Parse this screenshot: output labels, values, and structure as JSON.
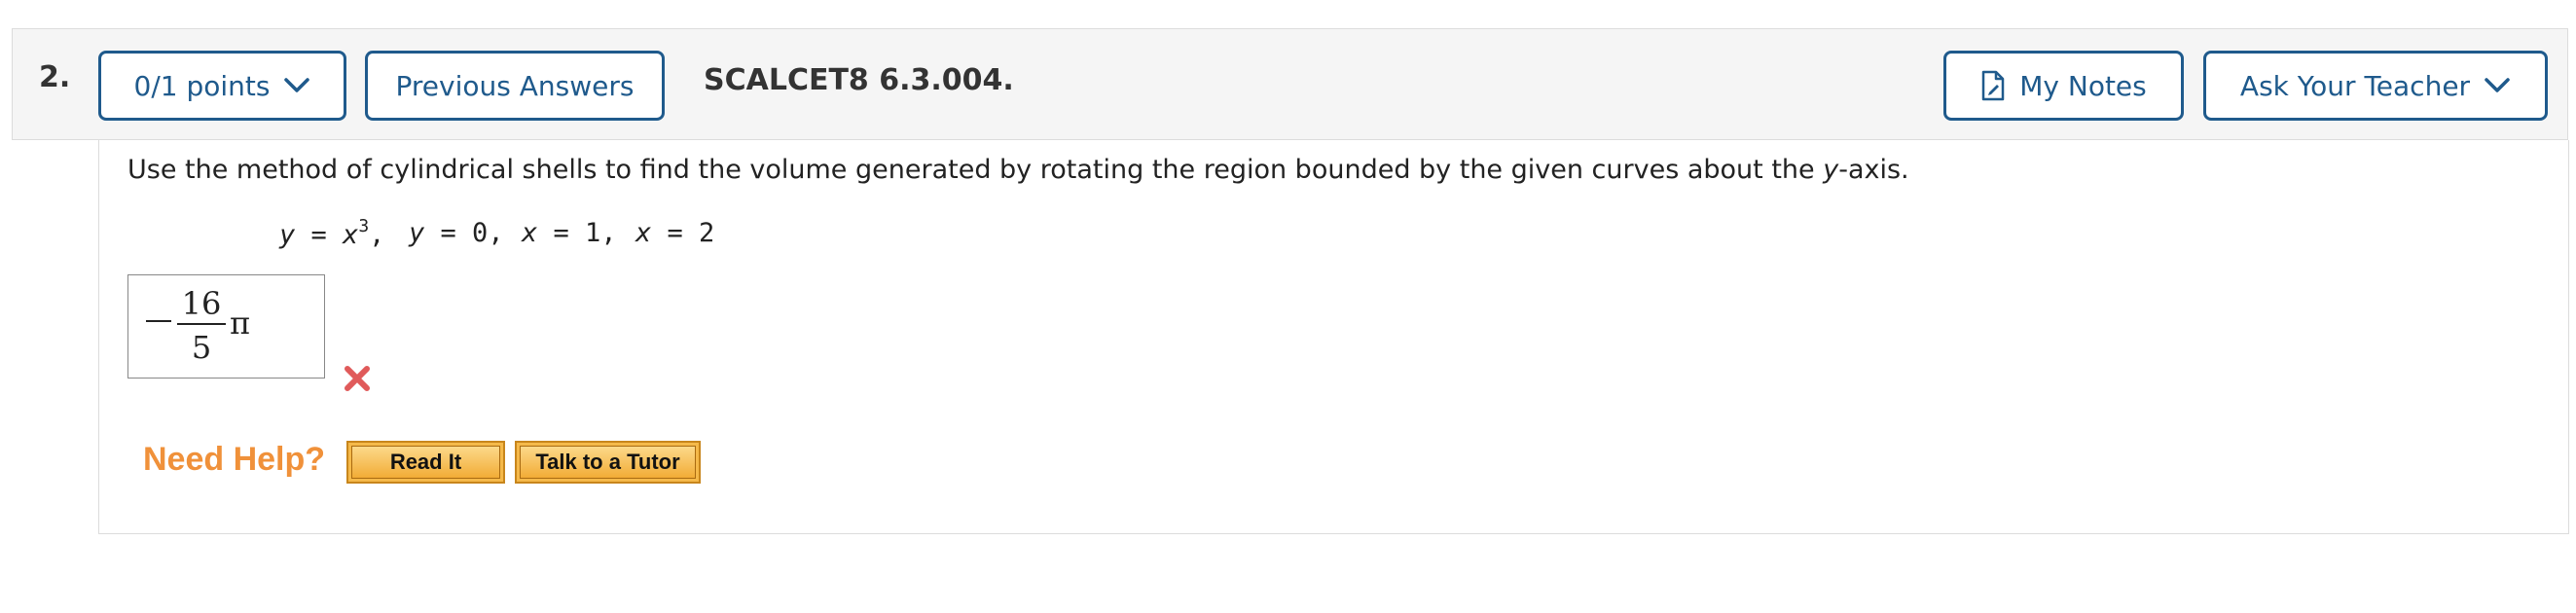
{
  "header": {
    "question_number": "2.",
    "points_label": "0/1 points",
    "previous_answers_label": "Previous Answers",
    "question_code": "SCALCET8 6.3.004.",
    "my_notes_label": "My Notes",
    "ask_teacher_label": "Ask Your Teacher"
  },
  "question": {
    "prompt_before": "Use the method of cylindrical shells to find the volume generated by rotating the region bounded by the given curves about the ",
    "prompt_axis": "y",
    "prompt_after": "-axis.",
    "equations": [
      {
        "var": "y",
        "rhs_var": "x",
        "exponent": "3",
        "rhs": "",
        "suffix": ","
      },
      {
        "var": "y",
        "rhs_var": "",
        "exponent": "",
        "rhs": "0",
        "suffix": ","
      },
      {
        "var": "x",
        "rhs_var": "",
        "exponent": "",
        "rhs": "1",
        "suffix": ","
      },
      {
        "var": "x",
        "rhs_var": "",
        "exponent": "",
        "rhs": "2",
        "suffix": ""
      }
    ]
  },
  "answer": {
    "numerator": "16",
    "denominator": "5",
    "symbol": "π",
    "status": "incorrect"
  },
  "help": {
    "label": "Need Help?",
    "read_it_label": "Read It",
    "tutor_label": "Talk to a Tutor"
  },
  "colors": {
    "accent": "#1f5a8c",
    "incorrect": "#e05a5a",
    "need_help": "#f0913a",
    "help_button": "#f5b94a"
  },
  "icons": {
    "points_dropdown": "chevron-down-icon",
    "notes": "notes-icon",
    "ask_dropdown": "chevron-down-icon",
    "wrong": "x-mark-icon"
  }
}
